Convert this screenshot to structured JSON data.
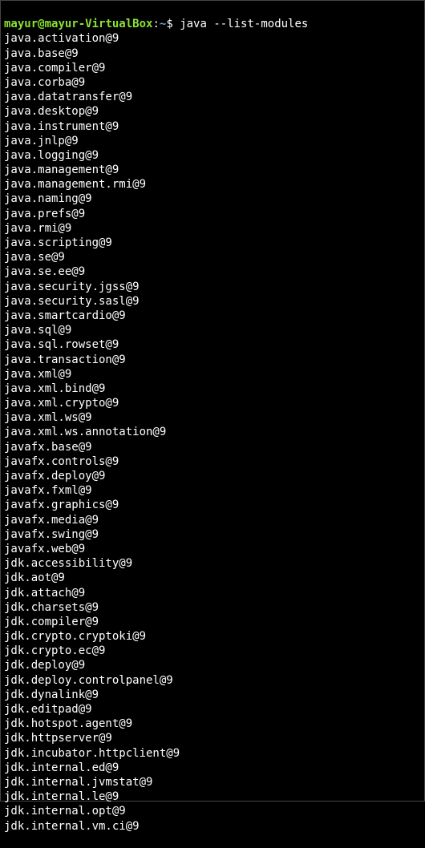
{
  "prompt": {
    "user": "mayur",
    "at": "@",
    "host": "mayur-VirtualBox",
    "colon": ":",
    "path": "~",
    "dollar": "$ "
  },
  "command": "java --list-modules",
  "modules": [
    "java.activation@9",
    "java.base@9",
    "java.compiler@9",
    "java.corba@9",
    "java.datatransfer@9",
    "java.desktop@9",
    "java.instrument@9",
    "java.jnlp@9",
    "java.logging@9",
    "java.management@9",
    "java.management.rmi@9",
    "java.naming@9",
    "java.prefs@9",
    "java.rmi@9",
    "java.scripting@9",
    "java.se@9",
    "java.se.ee@9",
    "java.security.jgss@9",
    "java.security.sasl@9",
    "java.smartcardio@9",
    "java.sql@9",
    "java.sql.rowset@9",
    "java.transaction@9",
    "java.xml@9",
    "java.xml.bind@9",
    "java.xml.crypto@9",
    "java.xml.ws@9",
    "java.xml.ws.annotation@9",
    "javafx.base@9",
    "javafx.controls@9",
    "javafx.deploy@9",
    "javafx.fxml@9",
    "javafx.graphics@9",
    "javafx.media@9",
    "javafx.swing@9",
    "javafx.web@9",
    "jdk.accessibility@9",
    "jdk.aot@9",
    "jdk.attach@9",
    "jdk.charsets@9",
    "jdk.compiler@9",
    "jdk.crypto.cryptoki@9",
    "jdk.crypto.ec@9",
    "jdk.deploy@9",
    "jdk.deploy.controlpanel@9",
    "jdk.dynalink@9",
    "jdk.editpad@9",
    "jdk.hotspot.agent@9",
    "jdk.httpserver@9",
    "jdk.incubator.httpclient@9",
    "jdk.internal.ed@9",
    "jdk.internal.jvmstat@9",
    "jdk.internal.le@9",
    "jdk.internal.opt@9",
    "jdk.internal.vm.ci@9"
  ]
}
